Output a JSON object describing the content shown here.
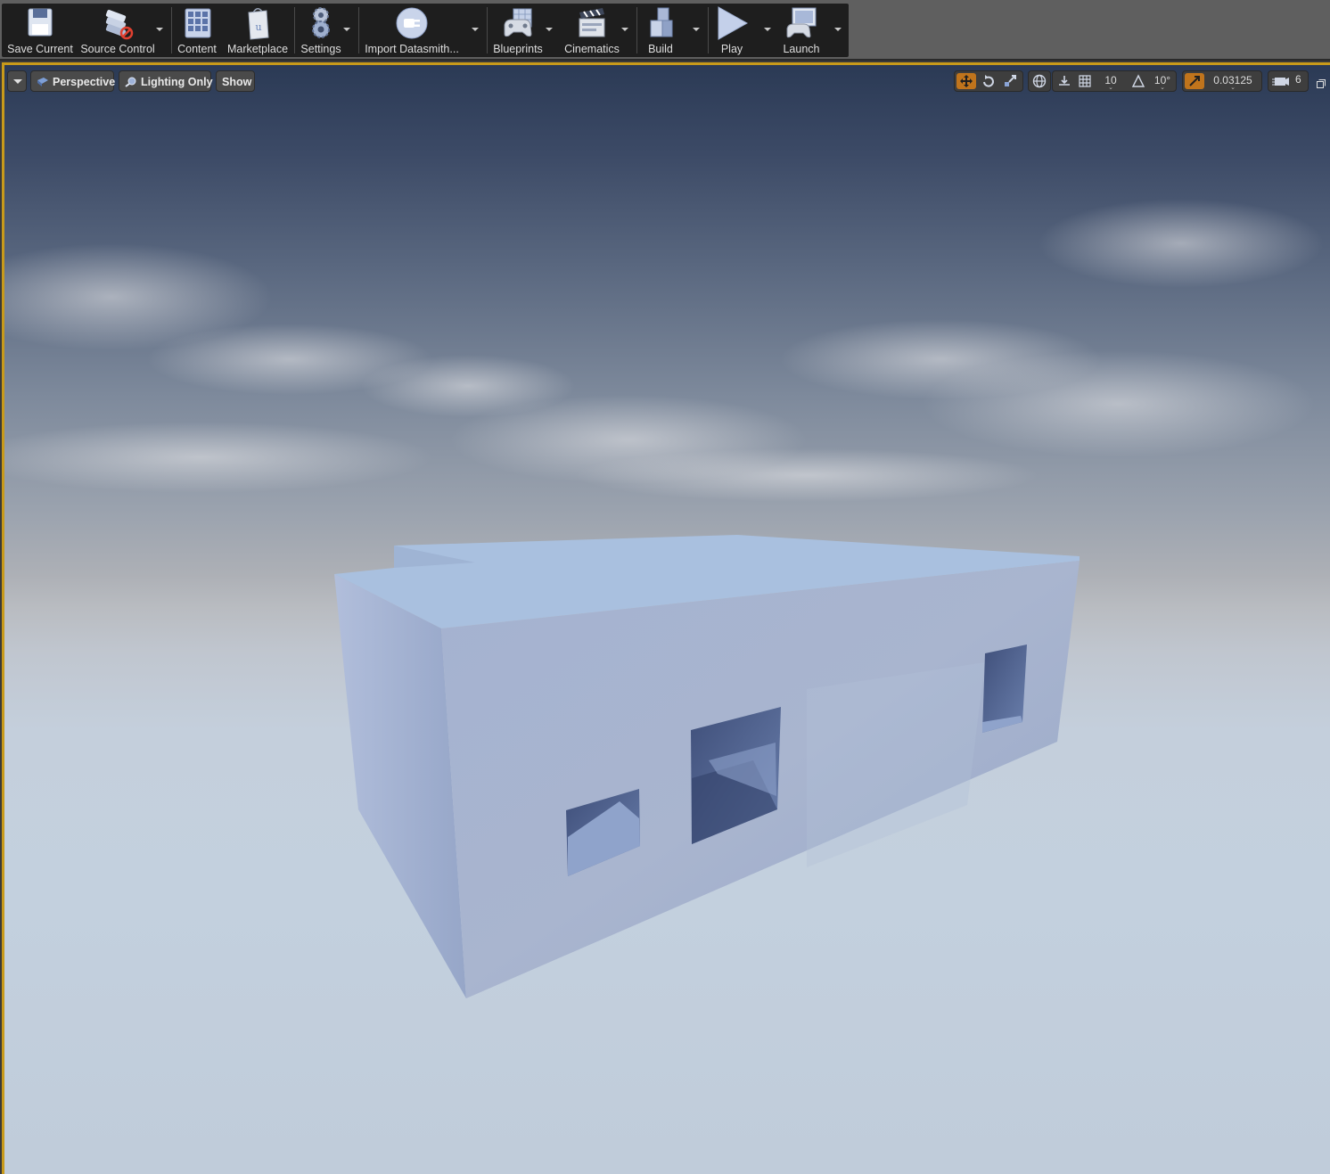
{
  "toolbar": {
    "buttons": [
      {
        "label": "Save Current",
        "icon": "floppy-disk-icon"
      },
      {
        "label": "Source Control",
        "icon": "source-control-icon"
      },
      {
        "label": "Content",
        "icon": "content-grid-icon"
      },
      {
        "label": "Marketplace",
        "icon": "marketplace-bag-icon"
      },
      {
        "label": "Settings",
        "icon": "settings-gears-icon"
      },
      {
        "label": "Import Datasmith...",
        "icon": "datasmith-plug-icon"
      },
      {
        "label": "Blueprints",
        "icon": "blueprints-gamepad-icon"
      },
      {
        "label": "Cinematics",
        "icon": "clapperboard-icon"
      },
      {
        "label": "Build",
        "icon": "build-blocks-icon"
      },
      {
        "label": "Play",
        "icon": "play-triangle-icon"
      },
      {
        "label": "Launch",
        "icon": "launch-monitor-icon"
      }
    ]
  },
  "viewport": {
    "menu_dropdown": "viewport-options",
    "view_mode": "Perspective",
    "lighting_mode": "Lighting Only",
    "show_label": "Show",
    "grid_snap": "10",
    "rotation_snap": "10°",
    "scale_snap": "0.03125",
    "camera_speed": "6",
    "colors": {
      "accent": "#c0741c",
      "viewport_border": "#c89a1a",
      "building": "#a3b3d1"
    }
  }
}
